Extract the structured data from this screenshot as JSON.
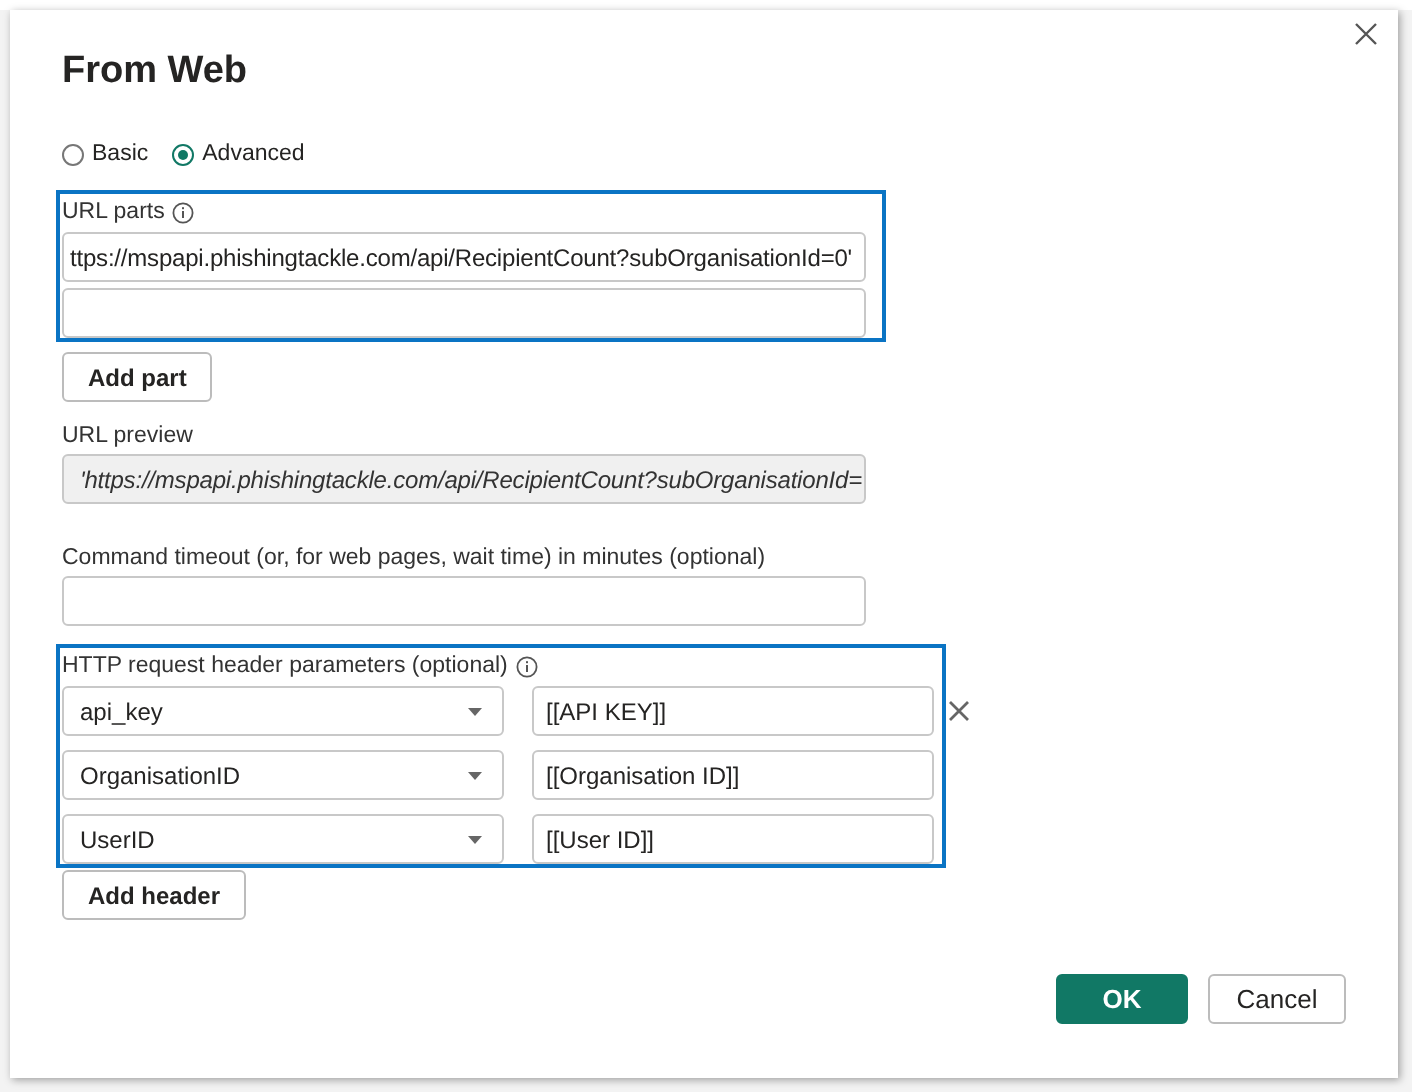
{
  "window": {
    "title": "From Web"
  },
  "modes": [
    {
      "label": "Basic",
      "selected": false
    },
    {
      "label": "Advanced",
      "selected": true
    }
  ],
  "url_parts": {
    "label": "URL parts",
    "parts": [
      {
        "value": "ttps://mspapi.phishingtackle.com/api/RecipientCount?subOrganisationId=0'"
      }
    ],
    "add_button": "Add part"
  },
  "url_preview": {
    "label": "URL preview",
    "value": "'https://mspapi.phishingtackle.com/api/RecipientCount?subOrganisationId="
  },
  "command_timeout": {
    "label": "Command timeout (or, for web pages, wait time) in minutes (optional)"
  },
  "headers": {
    "label": "HTTP request header parameters (optional)",
    "rows": [
      {
        "name": "api_key",
        "value": "[[API KEY]]"
      },
      {
        "name": "OrganisationID",
        "value": "[[Organisation ID]]"
      },
      {
        "name": "UserID",
        "value": "[[User ID]]"
      }
    ],
    "add_button": "Add header"
  },
  "buttons": {
    "ok": "OK",
    "cancel": "Cancel"
  }
}
